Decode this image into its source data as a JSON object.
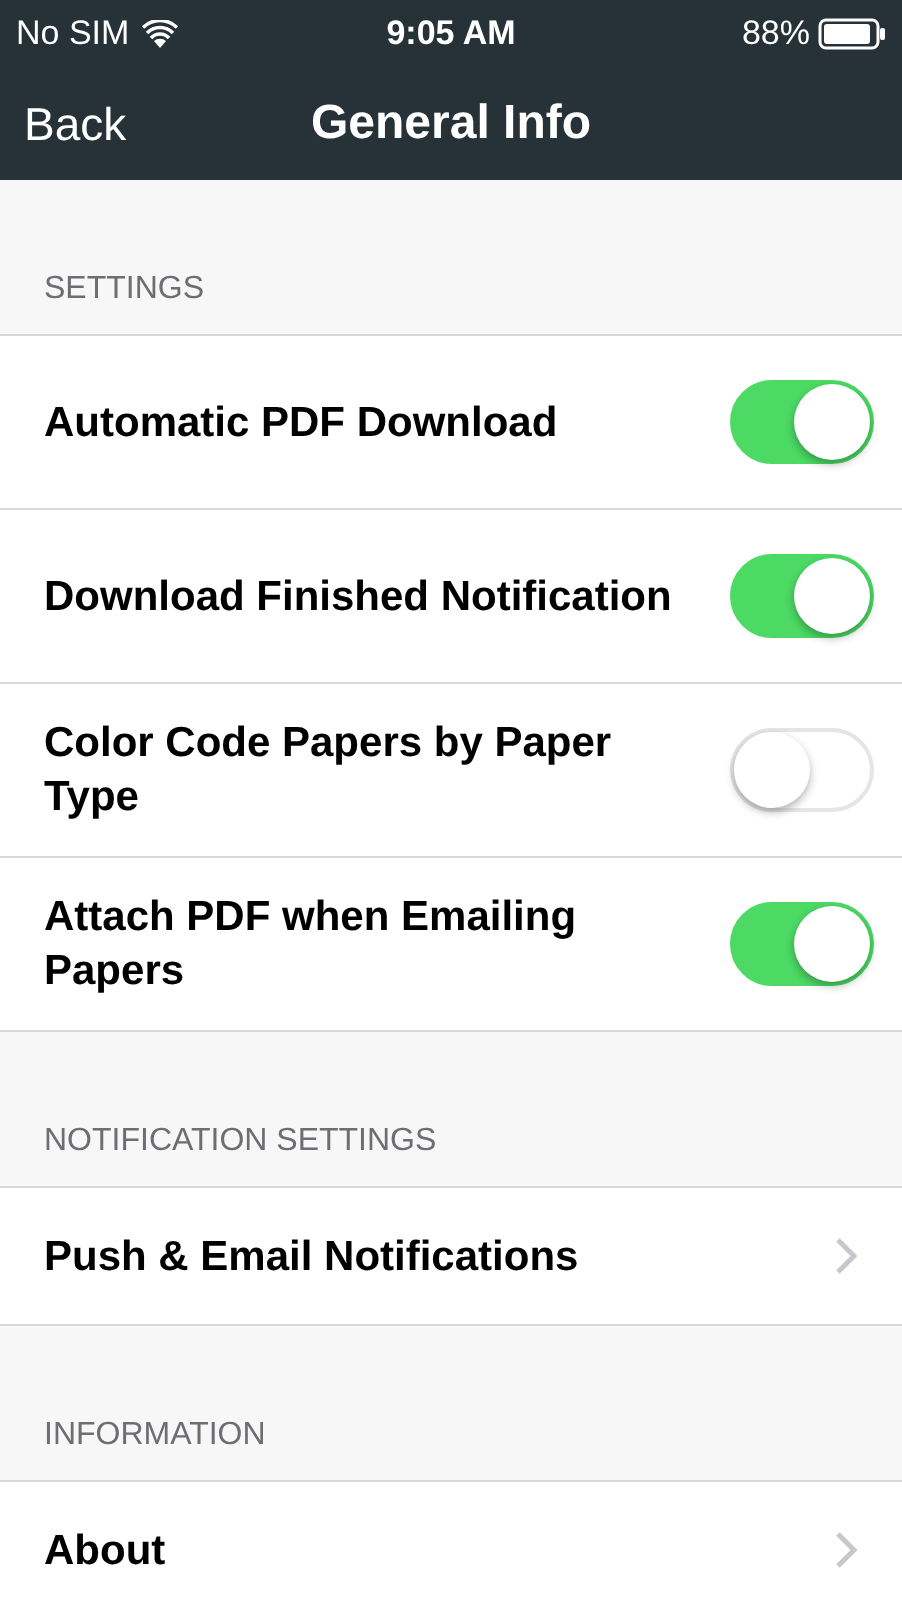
{
  "status_bar": {
    "carrier": "No SIM",
    "time": "9:05 AM",
    "battery": "88%"
  },
  "nav": {
    "back": "Back",
    "title": "General Info"
  },
  "sections": [
    {
      "header": "SETTINGS",
      "rows": [
        {
          "kind": "toggle",
          "label": "Automatic PDF Download",
          "on": true
        },
        {
          "kind": "toggle",
          "label": "Download Finished Notification",
          "on": true
        },
        {
          "kind": "toggle",
          "label": "Color Code Papers by Paper Type",
          "on": false
        },
        {
          "kind": "toggle",
          "label": "Attach PDF when Emailing Papers",
          "on": true
        }
      ]
    },
    {
      "header": "NOTIFICATION SETTINGS",
      "rows": [
        {
          "kind": "link",
          "label": "Push & Email Notifications"
        }
      ]
    },
    {
      "header": "INFORMATION",
      "rows": [
        {
          "kind": "link",
          "label": "About"
        }
      ]
    }
  ]
}
